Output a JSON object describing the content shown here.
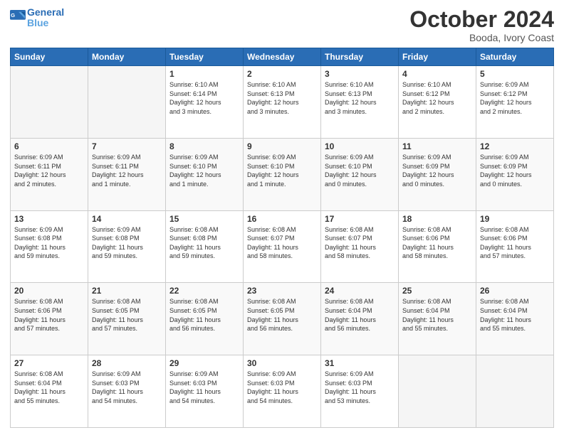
{
  "header": {
    "logo_line1": "General",
    "logo_line2": "Blue",
    "title": "October 2024",
    "subtitle": "Booda, Ivory Coast"
  },
  "days_of_week": [
    "Sunday",
    "Monday",
    "Tuesday",
    "Wednesday",
    "Thursday",
    "Friday",
    "Saturday"
  ],
  "weeks": [
    [
      {
        "day": "",
        "info": ""
      },
      {
        "day": "",
        "info": ""
      },
      {
        "day": "1",
        "info": "Sunrise: 6:10 AM\nSunset: 6:14 PM\nDaylight: 12 hours\nand 3 minutes."
      },
      {
        "day": "2",
        "info": "Sunrise: 6:10 AM\nSunset: 6:13 PM\nDaylight: 12 hours\nand 3 minutes."
      },
      {
        "day": "3",
        "info": "Sunrise: 6:10 AM\nSunset: 6:13 PM\nDaylight: 12 hours\nand 3 minutes."
      },
      {
        "day": "4",
        "info": "Sunrise: 6:10 AM\nSunset: 6:12 PM\nDaylight: 12 hours\nand 2 minutes."
      },
      {
        "day": "5",
        "info": "Sunrise: 6:09 AM\nSunset: 6:12 PM\nDaylight: 12 hours\nand 2 minutes."
      }
    ],
    [
      {
        "day": "6",
        "info": "Sunrise: 6:09 AM\nSunset: 6:11 PM\nDaylight: 12 hours\nand 2 minutes."
      },
      {
        "day": "7",
        "info": "Sunrise: 6:09 AM\nSunset: 6:11 PM\nDaylight: 12 hours\nand 1 minute."
      },
      {
        "day": "8",
        "info": "Sunrise: 6:09 AM\nSunset: 6:10 PM\nDaylight: 12 hours\nand 1 minute."
      },
      {
        "day": "9",
        "info": "Sunrise: 6:09 AM\nSunset: 6:10 PM\nDaylight: 12 hours\nand 1 minute."
      },
      {
        "day": "10",
        "info": "Sunrise: 6:09 AM\nSunset: 6:10 PM\nDaylight: 12 hours\nand 0 minutes."
      },
      {
        "day": "11",
        "info": "Sunrise: 6:09 AM\nSunset: 6:09 PM\nDaylight: 12 hours\nand 0 minutes."
      },
      {
        "day": "12",
        "info": "Sunrise: 6:09 AM\nSunset: 6:09 PM\nDaylight: 12 hours\nand 0 minutes."
      }
    ],
    [
      {
        "day": "13",
        "info": "Sunrise: 6:09 AM\nSunset: 6:08 PM\nDaylight: 11 hours\nand 59 minutes."
      },
      {
        "day": "14",
        "info": "Sunrise: 6:09 AM\nSunset: 6:08 PM\nDaylight: 11 hours\nand 59 minutes."
      },
      {
        "day": "15",
        "info": "Sunrise: 6:08 AM\nSunset: 6:08 PM\nDaylight: 11 hours\nand 59 minutes."
      },
      {
        "day": "16",
        "info": "Sunrise: 6:08 AM\nSunset: 6:07 PM\nDaylight: 11 hours\nand 58 minutes."
      },
      {
        "day": "17",
        "info": "Sunrise: 6:08 AM\nSunset: 6:07 PM\nDaylight: 11 hours\nand 58 minutes."
      },
      {
        "day": "18",
        "info": "Sunrise: 6:08 AM\nSunset: 6:06 PM\nDaylight: 11 hours\nand 58 minutes."
      },
      {
        "day": "19",
        "info": "Sunrise: 6:08 AM\nSunset: 6:06 PM\nDaylight: 11 hours\nand 57 minutes."
      }
    ],
    [
      {
        "day": "20",
        "info": "Sunrise: 6:08 AM\nSunset: 6:06 PM\nDaylight: 11 hours\nand 57 minutes."
      },
      {
        "day": "21",
        "info": "Sunrise: 6:08 AM\nSunset: 6:05 PM\nDaylight: 11 hours\nand 57 minutes."
      },
      {
        "day": "22",
        "info": "Sunrise: 6:08 AM\nSunset: 6:05 PM\nDaylight: 11 hours\nand 56 minutes."
      },
      {
        "day": "23",
        "info": "Sunrise: 6:08 AM\nSunset: 6:05 PM\nDaylight: 11 hours\nand 56 minutes."
      },
      {
        "day": "24",
        "info": "Sunrise: 6:08 AM\nSunset: 6:04 PM\nDaylight: 11 hours\nand 56 minutes."
      },
      {
        "day": "25",
        "info": "Sunrise: 6:08 AM\nSunset: 6:04 PM\nDaylight: 11 hours\nand 55 minutes."
      },
      {
        "day": "26",
        "info": "Sunrise: 6:08 AM\nSunset: 6:04 PM\nDaylight: 11 hours\nand 55 minutes."
      }
    ],
    [
      {
        "day": "27",
        "info": "Sunrise: 6:08 AM\nSunset: 6:04 PM\nDaylight: 11 hours\nand 55 minutes."
      },
      {
        "day": "28",
        "info": "Sunrise: 6:09 AM\nSunset: 6:03 PM\nDaylight: 11 hours\nand 54 minutes."
      },
      {
        "day": "29",
        "info": "Sunrise: 6:09 AM\nSunset: 6:03 PM\nDaylight: 11 hours\nand 54 minutes."
      },
      {
        "day": "30",
        "info": "Sunrise: 6:09 AM\nSunset: 6:03 PM\nDaylight: 11 hours\nand 54 minutes."
      },
      {
        "day": "31",
        "info": "Sunrise: 6:09 AM\nSunset: 6:03 PM\nDaylight: 11 hours\nand 53 minutes."
      },
      {
        "day": "",
        "info": ""
      },
      {
        "day": "",
        "info": ""
      }
    ]
  ]
}
